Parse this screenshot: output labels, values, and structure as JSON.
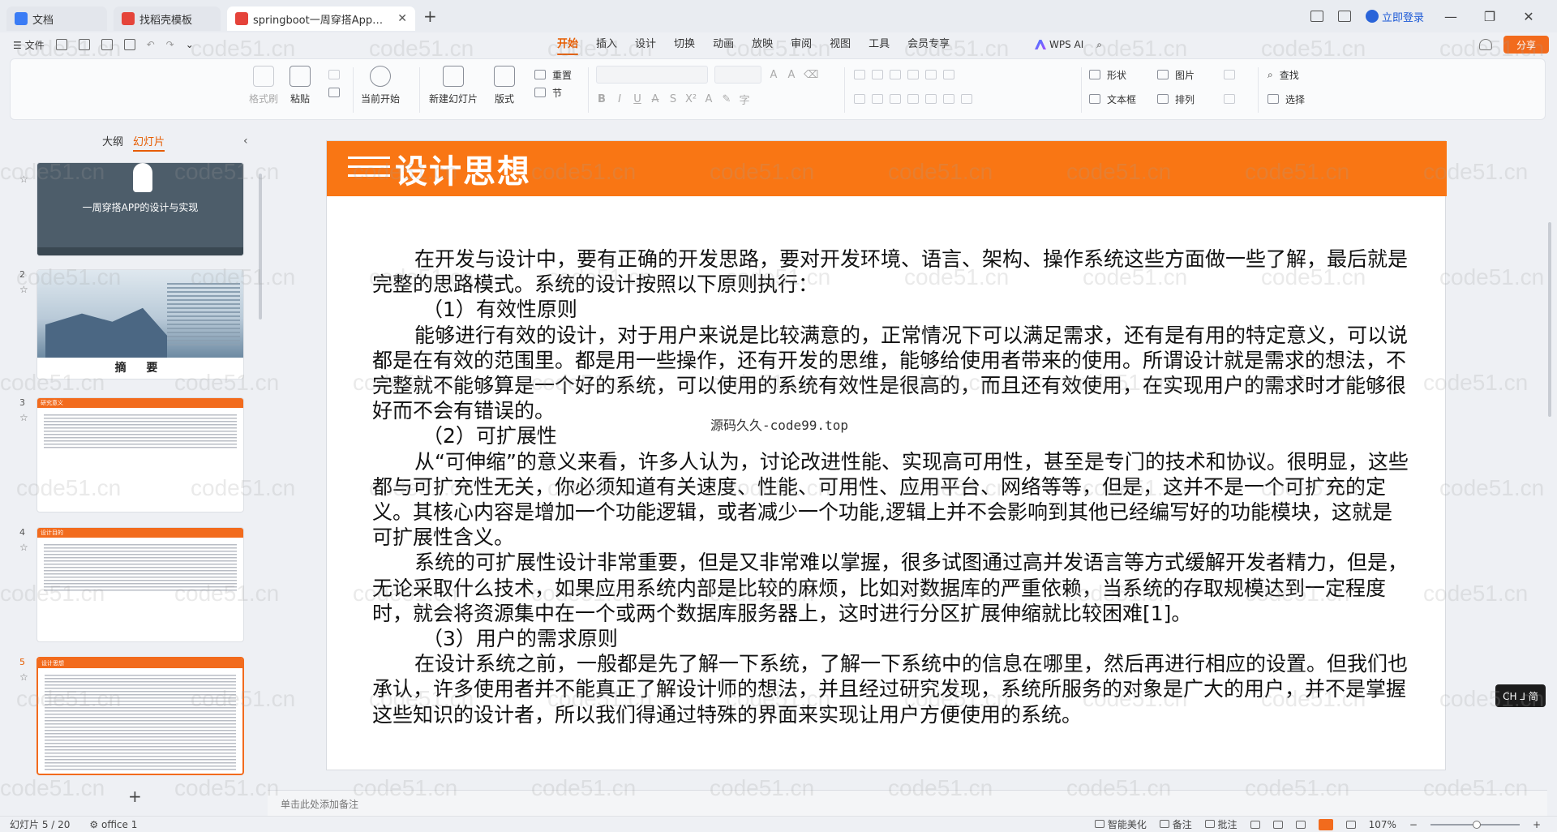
{
  "titlebar": {
    "tabs": [
      {
        "label": "文档"
      },
      {
        "label": "找稻壳模板"
      },
      {
        "label": "springboot一周穿搭App的设"
      }
    ],
    "login": "立即登录"
  },
  "menu": {
    "file": "文件",
    "tabs": [
      "开始",
      "插入",
      "设计",
      "切换",
      "动画",
      "放映",
      "审阅",
      "视图",
      "工具",
      "会员专享"
    ],
    "active_tab": "开始",
    "wps_ai": "WPS AI",
    "share": "分享"
  },
  "ribbon": {
    "format_painter": "格式刷",
    "paste": "粘贴",
    "start_from_current": "当前开始",
    "new_slide": "新建幻灯片",
    "layout": "版式",
    "reset": "重置",
    "section": "节",
    "shape": "形状",
    "picture": "图片",
    "find": "查找",
    "textbox": "文本框",
    "arrange": "排列",
    "select": "选择"
  },
  "left_panel": {
    "tab_outline": "大纲",
    "tab_slides": "幻灯片",
    "thumbs": [
      {
        "num": "",
        "title": "一周穿搭APP的设计与实现"
      },
      {
        "num": "2",
        "title": "摘 要"
      },
      {
        "num": "3",
        "title": "研究意义"
      },
      {
        "num": "4",
        "title": "设计目的"
      },
      {
        "num": "5",
        "title": "设计思想"
      }
    ]
  },
  "slide": {
    "title": "设计思想",
    "paragraphs": [
      {
        "style": "ind",
        "text": "在开发与设计中，要有正确的开发思路，要对开发环境、语言、架构、操作系统这些方面做一些了解，最后就是完整的思路模式。系统的设计按照以下原则执行："
      },
      {
        "style": "sub",
        "text": "（1）有效性原则"
      },
      {
        "style": "ind",
        "text": "能够进行有效的设计，对于用户来说是比较满意的，正常情况下可以满足需求，还有是有用的特定意义，可以说都是在有效的范围里。都是用一些操作，还有开发的思维，能够给使用者带来的使用。所谓设计就是需求的想法，不完整就不能够算是一个好的系统，可以使用的系统有效性是很高的，而且还有效使用，在实现用户的需求时才能够很好而不会有错误的。"
      },
      {
        "style": "sub",
        "text": "（2）可扩展性"
      },
      {
        "style": "ind",
        "text": "从“可伸缩”的意义来看，许多人认为，讨论改进性能、实现高可用性，甚至是专门的技术和协议。很明显，这些都与可扩充性无关，你必须知道有关速度、性能、可用性、应用平台、网络等等，但是，这并不是一个可扩充的定义。其核心内容是增加一个功能逻辑，或者减少一个功能,逻辑上并不会影响到其他已经编写好的功能模块，这就是可扩展性含义。"
      },
      {
        "style": "ind",
        "text": "系统的可扩展性设计非常重要，但是又非常难以掌握，很多试图通过高并发语言等方式缓解开发者精力，但是，无论采取什么技术，如果应用系统内部是比较的麻烦，比如对数据库的严重依赖，当系统的存取规模达到一定程度时，就会将资源集中在一个或两个数据库服务器上，这时进行分区扩展伸缩就比较困难[1]。"
      },
      {
        "style": "sub",
        "text": "（3）用户的需求原则"
      },
      {
        "style": "ind",
        "text": "在设计系统之前，一般都是先了解一下系统，了解一下系统中的信息在哪里，然后再进行相应的设置。但我们也承认，许多使用者并不能真正了解设计师的想法，并且经过研究发现，系统所服务的对象是广大的用户，并不是掌握这些知识的设计者，所以我们得通过特殊的界面来实现让用户方便使用的系统。"
      }
    ],
    "overlay": "源码久久-code99.top"
  },
  "notes_placeholder": "单击此处添加备注",
  "ime": "CH ⅃ 简",
  "status": {
    "slide_counter": "幻灯片 5 / 20",
    "theme": "office 1",
    "beautify": "智能美化",
    "notes": "备注",
    "comments": "批注",
    "zoom": "107%"
  },
  "watermark": "code51.cn"
}
